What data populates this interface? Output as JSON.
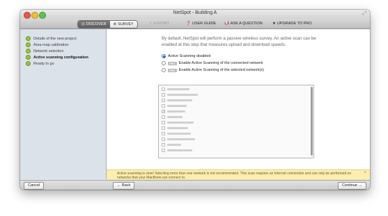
{
  "window": {
    "title": "NetSpot - Building A"
  },
  "toolbar": {
    "discover_label": "DISCOVER",
    "survey_label": "SURVEY",
    "export_label": "EXPORT",
    "user_guide_label": "USER GUIDE",
    "ask_label": "ASK A QUESTION",
    "upgrade_label": "UPGRADE TO PRO"
  },
  "sidebar": {
    "steps": [
      {
        "label": "Details of the new project"
      },
      {
        "label": "Area map calibration"
      },
      {
        "label": "Network selection"
      },
      {
        "label": "Active scanning configuration"
      },
      {
        "label": "Ready to go"
      }
    ]
  },
  "main": {
    "description": "By default, NetSpot will perform a passive wireless survey. An active scan can be enabled at this step that measures upload and download speeds.",
    "options": [
      {
        "label": "Active Scanning disabled",
        "selected": true,
        "pro": false
      },
      {
        "label": "Enable Active Scanning of the connected network",
        "selected": false,
        "pro": true
      },
      {
        "label": "Enable Active Scanning of the selected network(s)",
        "selected": false,
        "pro": true
      }
    ],
    "pro_badge": "PRO"
  },
  "warning": {
    "text": "Active scanning is slow! Selecting more than one network is not recommended. This scan requires an Internet connection and can only be performed on networks that your MacBook can connect to.",
    "close": "×"
  },
  "bottom": {
    "cancel_label": "Cancel",
    "back_label": "← Back",
    "continue_label": "Continue →"
  },
  "colors": {
    "step_dot": "#9bc53d",
    "warning_bg": "#fbeeb0",
    "sidebar_bg": "#dce2ea"
  }
}
